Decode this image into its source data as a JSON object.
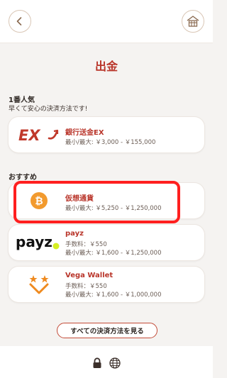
{
  "header": {
    "back_icon": "back-arrow-icon",
    "home_icon": "home-icon"
  },
  "page": {
    "title": "出金"
  },
  "popular": {
    "title": "1番人気",
    "subtitle": "早くて安心の決済方法です!",
    "items": [
      {
        "name": "銀行送金EX",
        "limits": "最小/最大: ￥3,000 - ￥155,000",
        "logo": "EX"
      }
    ]
  },
  "recommended": {
    "title": "おすすめ",
    "items": [
      {
        "name": "仮想通貨",
        "limits": "最小/最大: ￥5,250 - ￥1,250,000",
        "logo_icon": "bitcoin-icon"
      },
      {
        "name": "payz",
        "fee": "手数料：￥550",
        "limits": "最小/最大: ￥1,600 - ￥1,250,000",
        "logo": "payz"
      },
      {
        "name": "Vega Wallet",
        "fee": "手数料：￥550",
        "limits": "最小/最大: ￥1,600 - ￥1,000,000",
        "logo_icon": "vega-wallet-icon"
      }
    ]
  },
  "actions": {
    "all_methods": "すべての決済方法を見る"
  },
  "footer": {
    "icons": [
      "lock-icon",
      "globe-icon"
    ]
  },
  "colors": {
    "accent": "#b9352a",
    "highlight": "#ff1f1f",
    "background": "#f5f3f1"
  }
}
